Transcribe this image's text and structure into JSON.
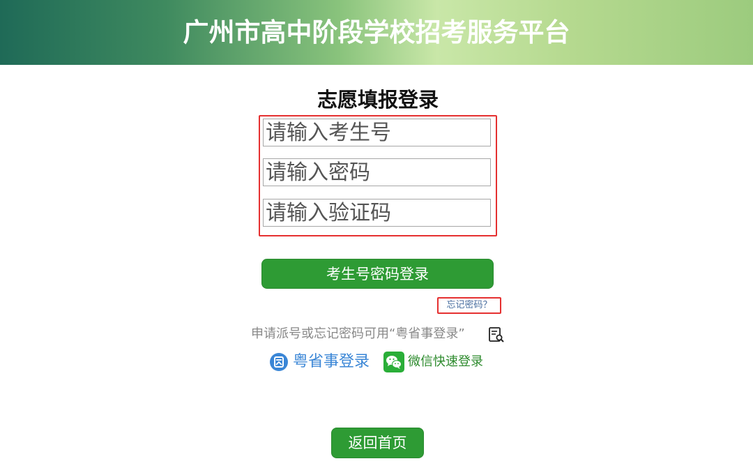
{
  "header": {
    "title": "广州市高中阶段学校招考服务平台"
  },
  "login": {
    "title": "志愿填报登录",
    "fields": {
      "exam_id_placeholder": "请输入考生号",
      "password_placeholder": "请输入密码",
      "captcha_placeholder": "请输入验证码"
    },
    "login_button": "考生号密码登录",
    "forgot_password": "忘记密码？",
    "hint": "申请派号或忘记密码可用“粤省事登录”",
    "yueshengshi_login": "粤省事登录",
    "wechat_login": "微信快速登录",
    "back_home": "返回首页"
  },
  "icons": {
    "hint_icon": "document-search-icon",
    "yueshengshi_icon": "yueshengshi-icon",
    "wechat_icon": "wechat-icon"
  },
  "colors": {
    "primary_green": "#2e9b34",
    "highlight_red": "#e53030",
    "link_blue": "#3a86d6"
  }
}
